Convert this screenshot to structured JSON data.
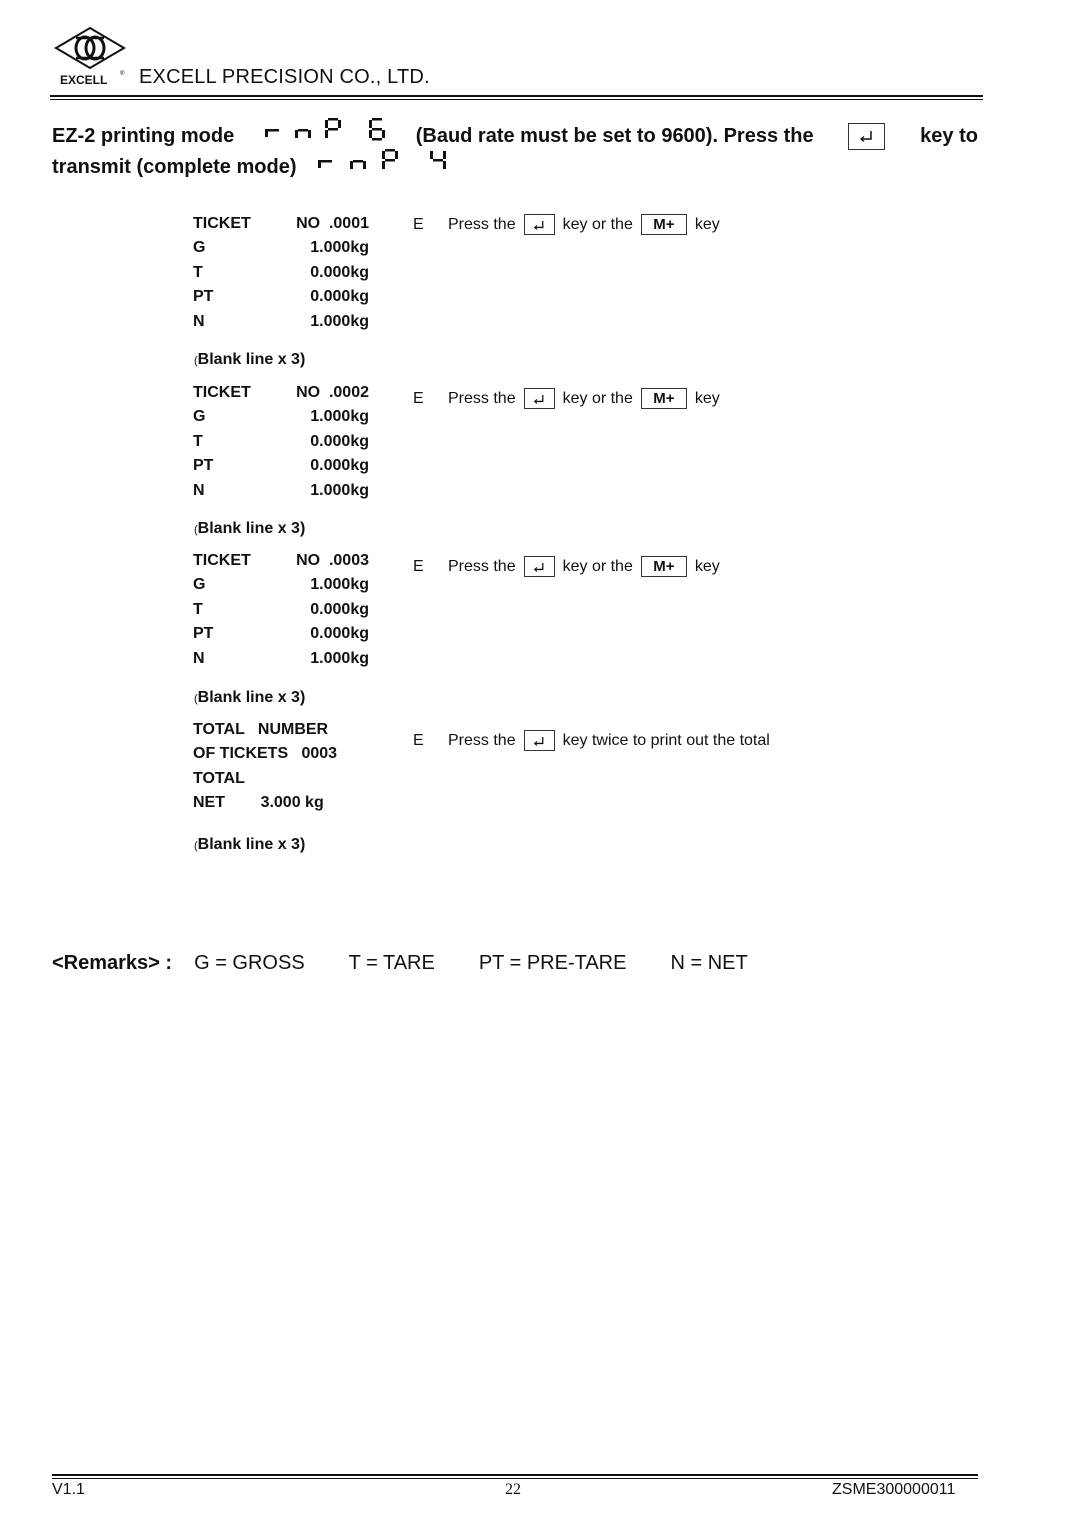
{
  "header": {
    "logo_text": "EXCELL",
    "logo_mark": "®",
    "company": "EXCELL PRECISION CO., LTD."
  },
  "title": {
    "line1_prefix": "EZ-2 printing mode",
    "mode1_display": "rnP6",
    "line1_middle": "(Baud rate must be set to 9600). Press the",
    "line1_suffix": "key to",
    "line2_prefix": "transmit (complete mode)",
    "mode2_display": "rnP4",
    "enter_key_icon": "enter-key-icon"
  },
  "tickets": [
    {
      "rows": [
        {
          "label": "TICKET",
          "value": "NO  .0001"
        },
        {
          "label": "G",
          "value": "1.000kg"
        },
        {
          "label": "T",
          "value": "0.000kg"
        },
        {
          "label": "PT",
          "value": "0.000kg"
        },
        {
          "label": "N",
          "value": "1.000kg"
        }
      ],
      "blank": "Blank line x 3)",
      "blank_paren": "(",
      "instruction": {
        "e": "E",
        "press": "Press the",
        "middle": "key or the",
        "mplus": "M+",
        "end": "key"
      }
    },
    {
      "rows": [
        {
          "label": "TICKET",
          "value": "NO  .0002"
        },
        {
          "label": "G",
          "value": "1.000kg"
        },
        {
          "label": "T",
          "value": "0.000kg"
        },
        {
          "label": "PT",
          "value": "0.000kg"
        },
        {
          "label": "N",
          "value": "1.000kg"
        }
      ],
      "blank": "Blank line x 3)",
      "blank_paren": "(",
      "instruction": {
        "e": "E",
        "press": "Press the",
        "middle": "key or the",
        "mplus": "M+",
        "end": "key"
      }
    },
    {
      "rows": [
        {
          "label": "TICKET",
          "value": "NO  .0003"
        },
        {
          "label": "G",
          "value": "1.000kg"
        },
        {
          "label": "T",
          "value": "0.000kg"
        },
        {
          "label": "PT",
          "value": "0.000kg"
        },
        {
          "label": "N",
          "value": "1.000kg"
        }
      ],
      "blank": "Blank line x 3)",
      "blank_paren": "(",
      "instruction": {
        "e": "E",
        "press": "Press the",
        "middle": "key or the",
        "mplus": "M+",
        "end": "key"
      }
    }
  ],
  "total": {
    "rows": [
      "TOTAL   NUMBER",
      "OF TICKETS   0003",
      "TOTAL",
      "NET        3.000 kg"
    ],
    "blank": "Blank line x 3)",
    "blank_paren": "(",
    "instruction": {
      "e": "E",
      "press": "Press the",
      "end": "key twice to print out the total"
    }
  },
  "remarks": {
    "head": "<Remarks> :",
    "items": [
      "G = GROSS",
      "T = TARE",
      "PT = PRE-TARE",
      "N = NET"
    ]
  },
  "footer": {
    "version": "V1.1",
    "page": "22",
    "doc_id": "ZSME300000011"
  }
}
